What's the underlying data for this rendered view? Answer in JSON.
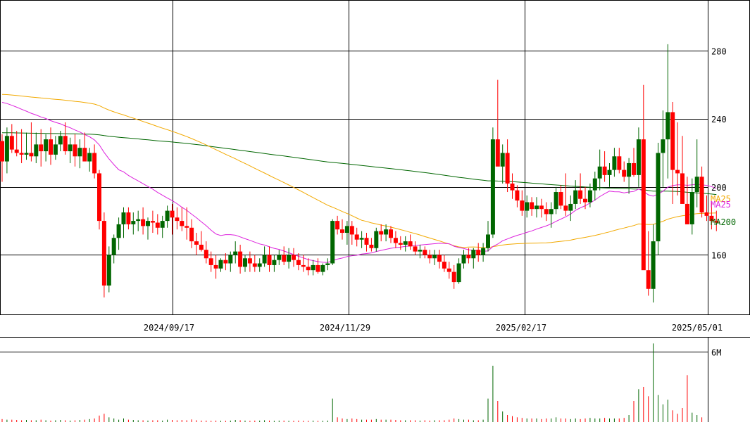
{
  "chart_data": {
    "type": "candlestick",
    "y_axis": {
      "ticks": [
        160,
        200,
        240,
        280
      ],
      "range": [
        125,
        310
      ]
    },
    "volume_axis": {
      "ticks": [
        {
          "value": 6,
          "label": "6M"
        }
      ],
      "range": [
        0,
        7.2
      ]
    },
    "x_axis": {
      "labels": [
        "2024/09/17",
        "2024/11/29",
        "2025/02/17",
        "2025/05/01"
      ]
    },
    "moving_average_legend": [
      {
        "label": "MA25",
        "color": "#f2a900"
      },
      {
        "label": "MA25",
        "color": "#dd22dd"
      },
      {
        "label": "MA200",
        "color": "#006600"
      }
    ],
    "colors": {
      "up": "#006600",
      "down": "#ff0000",
      "ma_short": "#dd22dd",
      "ma_mid": "#f2a900",
      "ma_long": "#006600",
      "grid": "#000000"
    },
    "candles": [
      [
        227,
        231,
        203,
        215
      ],
      [
        215,
        235,
        208,
        230
      ],
      [
        230,
        237,
        220,
        222
      ],
      [
        222,
        233,
        218,
        220
      ],
      [
        220,
        234,
        214,
        219
      ],
      [
        219,
        232,
        216,
        220
      ],
      [
        220,
        238,
        215,
        218
      ],
      [
        218,
        232,
        214,
        225
      ],
      [
        225,
        234,
        212,
        221
      ],
      [
        221,
        231,
        215,
        228
      ],
      [
        228,
        235,
        213,
        219
      ],
      [
        219,
        230,
        216,
        225
      ],
      [
        225,
        233,
        221,
        230
      ],
      [
        230,
        238,
        219,
        221
      ],
      [
        221,
        229,
        214,
        225
      ],
      [
        225,
        231,
        212,
        218
      ],
      [
        218,
        228,
        211,
        223
      ],
      [
        223,
        232,
        218,
        215
      ],
      [
        215,
        223,
        209,
        220
      ],
      [
        220,
        225,
        205,
        208
      ],
      [
        208,
        210,
        175,
        180
      ],
      [
        180,
        185,
        135,
        142
      ],
      [
        142,
        165,
        138,
        160
      ],
      [
        160,
        172,
        155,
        170
      ],
      [
        170,
        182,
        163,
        178
      ],
      [
        178,
        188,
        170,
        185
      ],
      [
        185,
        188,
        175,
        178
      ],
      [
        178,
        185,
        172,
        180
      ],
      [
        180,
        186,
        174,
        181
      ],
      [
        181,
        188,
        172,
        177
      ],
      [
        177,
        182,
        169,
        180
      ],
      [
        180,
        186,
        173,
        179
      ],
      [
        179,
        184,
        172,
        176
      ],
      [
        176,
        183,
        170,
        180
      ],
      [
        180,
        189,
        176,
        186
      ],
      [
        186,
        190,
        172,
        182
      ],
      [
        182,
        188,
        175,
        180
      ],
      [
        180,
        188,
        174,
        177
      ],
      [
        177,
        188,
        169,
        176
      ],
      [
        176,
        181,
        164,
        168
      ],
      [
        168,
        173,
        160,
        166
      ],
      [
        166,
        174,
        162,
        163
      ],
      [
        163,
        168,
        155,
        158
      ],
      [
        158,
        162,
        150,
        154
      ],
      [
        154,
        160,
        146,
        152
      ],
      [
        152,
        158,
        150,
        157
      ],
      [
        157,
        161,
        151,
        155
      ],
      [
        155,
        162,
        150,
        160
      ],
      [
        160,
        168,
        155,
        162
      ],
      [
        162,
        166,
        149,
        153
      ],
      [
        153,
        160,
        150,
        158
      ],
      [
        158,
        162,
        150,
        155
      ],
      [
        155,
        160,
        150,
        153
      ],
      [
        153,
        158,
        150,
        155
      ],
      [
        155,
        165,
        153,
        160
      ],
      [
        160,
        165,
        150,
        154
      ],
      [
        154,
        160,
        150,
        157
      ],
      [
        157,
        163,
        154,
        160
      ],
      [
        160,
        165,
        154,
        156
      ],
      [
        156,
        164,
        152,
        160
      ],
      [
        160,
        164,
        153,
        157
      ],
      [
        157,
        161,
        151,
        154
      ],
      [
        154,
        160,
        150,
        153
      ],
      [
        153,
        158,
        148,
        151
      ],
      [
        151,
        157,
        148,
        154
      ],
      [
        154,
        158,
        149,
        150
      ],
      [
        150,
        155,
        148,
        154
      ],
      [
        154,
        158,
        151,
        155
      ],
      [
        155,
        181,
        154,
        180
      ],
      [
        180,
        183,
        172,
        175
      ],
      [
        175,
        181,
        169,
        173
      ],
      [
        173,
        180,
        166,
        177
      ],
      [
        177,
        180,
        166,
        172
      ],
      [
        172,
        176,
        165,
        169
      ],
      [
        169,
        174,
        164,
        170
      ],
      [
        170,
        173,
        162,
        166
      ],
      [
        166,
        170,
        162,
        164
      ],
      [
        164,
        176,
        162,
        174
      ],
      [
        174,
        178,
        168,
        172
      ],
      [
        172,
        178,
        168,
        175
      ],
      [
        175,
        177,
        167,
        170
      ],
      [
        170,
        174,
        164,
        167
      ],
      [
        167,
        171,
        163,
        166
      ],
      [
        166,
        171,
        162,
        168
      ],
      [
        168,
        172,
        163,
        165
      ],
      [
        165,
        168,
        160,
        162
      ],
      [
        162,
        166,
        158,
        163
      ],
      [
        163,
        165,
        158,
        160
      ],
      [
        160,
        163,
        155,
        158
      ],
      [
        158,
        163,
        154,
        160
      ],
      [
        160,
        163,
        152,
        156
      ],
      [
        156,
        160,
        150,
        152
      ],
      [
        152,
        156,
        146,
        150
      ],
      [
        150,
        154,
        140,
        144
      ],
      [
        144,
        158,
        143,
        155
      ],
      [
        155,
        163,
        152,
        160
      ],
      [
        160,
        164,
        155,
        158
      ],
      [
        158,
        164,
        152,
        163
      ],
      [
        163,
        167,
        156,
        160
      ],
      [
        160,
        167,
        156,
        164
      ],
      [
        164,
        180,
        162,
        172
      ],
      [
        172,
        235,
        170,
        228
      ],
      [
        228,
        263,
        215,
        212
      ],
      [
        212,
        225,
        202,
        220
      ],
      [
        220,
        228,
        197,
        202
      ],
      [
        202,
        208,
        193,
        198
      ],
      [
        198,
        201,
        188,
        192
      ],
      [
        192,
        198,
        183,
        186
      ],
      [
        186,
        195,
        182,
        191
      ],
      [
        191,
        194,
        183,
        187
      ],
      [
        187,
        194,
        182,
        189
      ],
      [
        189,
        193,
        182,
        187
      ],
      [
        187,
        191,
        180,
        184
      ],
      [
        184,
        191,
        176,
        187
      ],
      [
        187,
        200,
        184,
        197
      ],
      [
        197,
        201,
        187,
        189
      ],
      [
        189,
        208,
        183,
        186
      ],
      [
        186,
        195,
        180,
        190
      ],
      [
        190,
        204,
        187,
        198
      ],
      [
        198,
        208,
        190,
        193
      ],
      [
        193,
        200,
        187,
        191
      ],
      [
        191,
        202,
        188,
        198
      ],
      [
        198,
        209,
        192,
        205
      ],
      [
        205,
        222,
        198,
        212
      ],
      [
        212,
        221,
        203,
        207
      ],
      [
        207,
        214,
        200,
        210
      ],
      [
        210,
        223,
        206,
        218
      ],
      [
        218,
        223,
        208,
        210
      ],
      [
        210,
        215,
        203,
        206
      ],
      [
        206,
        217,
        196,
        214
      ],
      [
        214,
        223,
        206,
        207
      ],
      [
        207,
        235,
        200,
        228
      ],
      [
        228,
        260,
        166,
        151
      ],
      [
        151,
        174,
        136,
        140
      ],
      [
        140,
        178,
        132,
        168
      ],
      [
        168,
        226,
        160,
        220
      ],
      [
        220,
        245,
        200,
        228
      ],
      [
        228,
        284,
        205,
        244
      ],
      [
        244,
        250,
        190,
        210
      ],
      [
        210,
        238,
        195,
        208
      ],
      [
        208,
        230,
        194,
        190
      ],
      [
        190,
        206,
        178,
        178
      ],
      [
        178,
        205,
        172,
        197
      ],
      [
        197,
        228,
        188,
        206
      ],
      [
        206,
        212,
        182,
        185
      ],
      [
        185,
        195,
        180,
        183
      ],
      [
        183,
        191,
        175,
        180
      ],
      [
        180,
        186,
        174,
        179
      ]
    ],
    "volumes": [
      0.25,
      0.2,
      0.2,
      0.18,
      0.15,
      0.18,
      0.15,
      0.15,
      0.2,
      0.15,
      0.12,
      0.15,
      0.18,
      0.15,
      0.12,
      0.15,
      0.18,
      0.2,
      0.25,
      0.3,
      0.55,
      0.7,
      0.4,
      0.3,
      0.2,
      0.3,
      0.2,
      0.18,
      0.15,
      0.15,
      0.12,
      0.15,
      0.15,
      0.12,
      0.2,
      0.18,
      0.15,
      0.18,
      0.15,
      0.22,
      0.15,
      0.12,
      0.12,
      0.1,
      0.12,
      0.1,
      0.1,
      0.12,
      0.18,
      0.15,
      0.12,
      0.1,
      0.12,
      0.12,
      0.15,
      0.12,
      0.1,
      0.12,
      0.12,
      0.1,
      0.1,
      0.12,
      0.1,
      0.1,
      0.12,
      0.1,
      0.1,
      0.12,
      2.0,
      0.4,
      0.3,
      0.25,
      0.3,
      0.25,
      0.2,
      0.2,
      0.2,
      0.25,
      0.2,
      0.2,
      0.2,
      0.18,
      0.15,
      0.15,
      0.15,
      0.15,
      0.12,
      0.15,
      0.12,
      0.15,
      0.15,
      0.15,
      0.2,
      0.3,
      0.25,
      0.2,
      0.2,
      0.15,
      0.15,
      0.2,
      2.0,
      4.8,
      1.8,
      0.9,
      0.6,
      0.5,
      0.4,
      0.35,
      0.3,
      0.3,
      0.3,
      0.25,
      0.3,
      0.3,
      0.4,
      0.3,
      0.3,
      0.25,
      0.3,
      0.25,
      0.3,
      0.35,
      0.3,
      0.3,
      0.35,
      0.3,
      0.3,
      0.3,
      0.35,
      0.6,
      1.8,
      2.8,
      3.0,
      2.2,
      6.7,
      2.3,
      1.5,
      1.9,
      1.0,
      0.7,
      1.2,
      4.0,
      0.8,
      0.6,
      0.4
    ]
  }
}
